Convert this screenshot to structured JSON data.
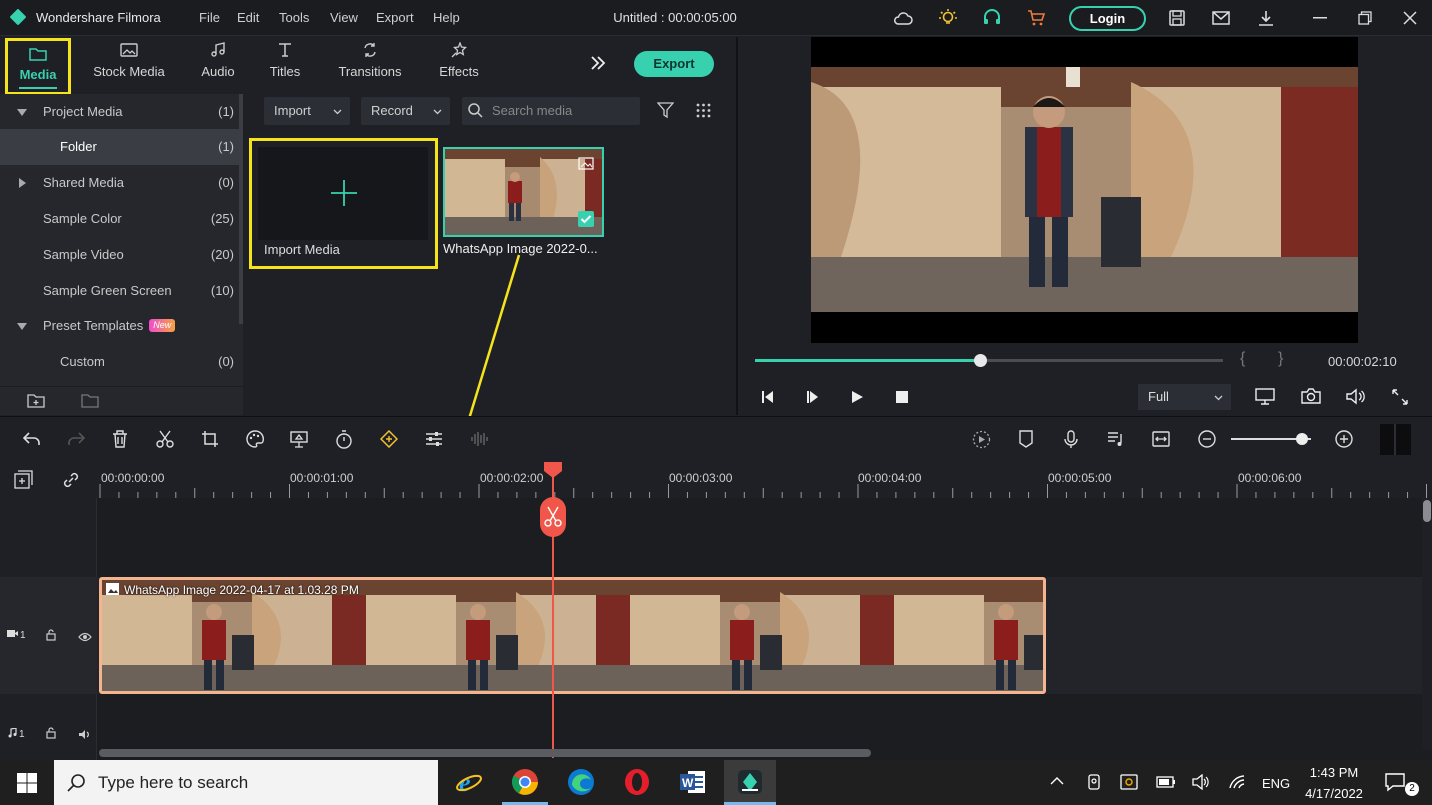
{
  "app": {
    "name": "Wondershare Filmora",
    "document_title": "Untitled : 00:00:05:00"
  },
  "menu": [
    "File",
    "Edit",
    "Tools",
    "View",
    "Export",
    "Help"
  ],
  "header_actions": {
    "login_label": "Login"
  },
  "tabs": [
    {
      "label": "Media",
      "icon": "folder-icon",
      "active": true
    },
    {
      "label": "Stock Media",
      "icon": "stock-media-icon"
    },
    {
      "label": "Audio",
      "icon": "music-note-icon"
    },
    {
      "label": "Titles",
      "icon": "text-icon"
    },
    {
      "label": "Transitions",
      "icon": "transition-icon"
    },
    {
      "label": "Effects",
      "icon": "effects-icon"
    }
  ],
  "export_label": "Export",
  "media_tree": [
    {
      "label": "Project Media",
      "count": "(1)",
      "expanded": true
    },
    {
      "label": "Folder",
      "count": "(1)",
      "selected": true
    },
    {
      "label": "Shared Media",
      "count": "(0)"
    },
    {
      "label": "Sample Color",
      "count": "(25)"
    },
    {
      "label": "Sample Video",
      "count": "(20)"
    },
    {
      "label": "Sample Green Screen",
      "count": "(10)"
    },
    {
      "label": "Preset Templates",
      "count": "",
      "badge": "New",
      "expanded": true
    },
    {
      "label": "Custom",
      "count": "(0)"
    }
  ],
  "media_toolbar": {
    "import_label": "Import",
    "record_label": "Record",
    "search_placeholder": "Search media"
  },
  "media_items": [
    {
      "label": "Import Media"
    },
    {
      "label": "WhatsApp Image 2022-0..."
    }
  ],
  "player": {
    "timecode": "00:00:02:10",
    "progress": 0.48,
    "quality": "Full"
  },
  "timeline": {
    "ruler_labels": [
      "00:00:00:00",
      "00:00:01:00",
      "00:00:02:00",
      "00:00:03:00",
      "00:00:04:00",
      "00:00:05:00",
      "00:00:06:00"
    ],
    "clip_title": "WhatsApp Image 2022-04-17 at 1.03.28 PM",
    "video_track_label": "1",
    "audio_track_label": "1"
  },
  "taskbar": {
    "search_placeholder": "Type here to search",
    "language": "ENG",
    "time": "1:43 PM",
    "date": "4/17/2022",
    "notification_count": "2"
  },
  "colors": {
    "accent": "#38d1b0",
    "highlight": "#f5e31b",
    "playhead": "#f0574a",
    "clip_border": "#f3b58f"
  }
}
